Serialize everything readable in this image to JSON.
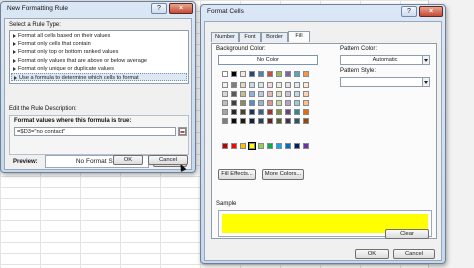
{
  "rule_dialog": {
    "title": "New Formatting Rule",
    "close_label": "×",
    "help_label": "?",
    "select_type_label": "Select a Rule Type:",
    "rule_types": [
      {
        "label": "Format all cells based on their values",
        "selected": false
      },
      {
        "label": "Format only cells that contain",
        "selected": false
      },
      {
        "label": "Format only top or bottom ranked values",
        "selected": false
      },
      {
        "label": "Format only values that are above or below average",
        "selected": false
      },
      {
        "label": "Format only unique or duplicate values",
        "selected": false
      },
      {
        "label": "Use a formula to determine which cells to format",
        "selected": true
      }
    ],
    "edit_desc_label": "Edit the Rule Description:",
    "formula_label": "Format values where this formula is true:",
    "formula_value": "=$D3=\"no contact\"",
    "preview_label": "Preview:",
    "preview_text": "No Format Set",
    "format_button": "Format...",
    "ok_button": "OK",
    "cancel_button": "Cancel"
  },
  "format_dialog": {
    "title": "Format Cells",
    "close_label": "×",
    "help_label": "?",
    "tabs": [
      {
        "label": "Number",
        "active": false
      },
      {
        "label": "Font",
        "active": false
      },
      {
        "label": "Border",
        "active": false
      },
      {
        "label": "Fill",
        "active": true
      }
    ],
    "background_color_label": "Background Color:",
    "no_color_label": "No Color",
    "pattern_color_label": "Pattern Color:",
    "pattern_color_value": "Automatic",
    "pattern_style_label": "Pattern Style:",
    "pattern_style_value": "",
    "fill_effects_button": "Fill Effects...",
    "more_colors_button": "More Colors...",
    "sample_label": "Sample",
    "sample_color": "#ffff00",
    "clear_button": "Clear",
    "ok_button": "OK",
    "cancel_button": "Cancel",
    "palette_top_row": [
      "#ffffff",
      "#000000",
      "#eeece1",
      "#1f497d",
      "#4f81bd",
      "#c0504d",
      "#9bbb59",
      "#8064a2",
      "#4bacc6",
      "#f79646"
    ],
    "palette_theme_rows": [
      [
        "#f2f2f2",
        "#7f7f7f",
        "#ddd9c3",
        "#c6d9f0",
        "#dbe5f1",
        "#f2dcdb",
        "#ebf1dd",
        "#e5e0ec",
        "#dbeef3",
        "#fdeada"
      ],
      [
        "#d8d8d8",
        "#595959",
        "#c4bd97",
        "#8db3e2",
        "#b8cce4",
        "#e5b9b7",
        "#d7e3bc",
        "#ccc1d9",
        "#b7dde8",
        "#fbd5b5"
      ],
      [
        "#bfbfbf",
        "#3f3f3f",
        "#938953",
        "#548dd4",
        "#95b3d7",
        "#d99694",
        "#c3d69b",
        "#b2a2c7",
        "#92cddc",
        "#fac08f"
      ],
      [
        "#a5a5a5",
        "#262626",
        "#494429",
        "#17365d",
        "#366092",
        "#953734",
        "#76923c",
        "#5f497a",
        "#31859b",
        "#e36c09"
      ],
      [
        "#7f7f7f",
        "#0c0c0c",
        "#1d1b10",
        "#0f243e",
        "#244061",
        "#632423",
        "#4f6128",
        "#3f3151",
        "#205867",
        "#974806"
      ]
    ],
    "palette_standard_row": [
      "#c00000",
      "#ff0000",
      "#ffc000",
      "#ffff00",
      "#92d050",
      "#00b050",
      "#00b0f0",
      "#0070c0",
      "#002060",
      "#7030a0"
    ],
    "selected_color": "#ffff00"
  },
  "colors": {
    "title_bg": "#c9daef",
    "client_bg": "#f0f0f0",
    "close_button": "#c64a34",
    "selection": "#dde8f5"
  }
}
